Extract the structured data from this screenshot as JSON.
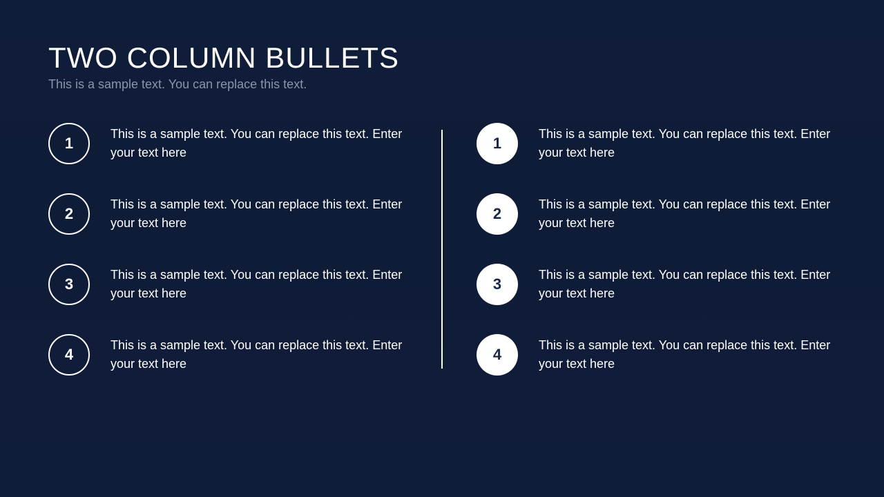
{
  "title": "TWO COLUMN BULLETS",
  "subtitle": "This is a sample text. You can replace this text.",
  "leftColumn": {
    "items": [
      {
        "num": "1",
        "text": "This is a sample text. You can replace this text. Enter your text here"
      },
      {
        "num": "2",
        "text": "This is a sample text. You can replace this text. Enter your text here"
      },
      {
        "num": "3",
        "text": "This is a sample text. You can replace this text. Enter your text here"
      },
      {
        "num": "4",
        "text": "This is a sample text. You can replace this text. Enter your text here"
      }
    ]
  },
  "rightColumn": {
    "items": [
      {
        "num": "1",
        "text": "This is a sample text. You can replace this text. Enter your text here"
      },
      {
        "num": "2",
        "text": "This is a sample text. You can replace this text. Enter your text here"
      },
      {
        "num": "3",
        "text": "This is a sample text. You can replace this text. Enter your text here"
      },
      {
        "num": "4",
        "text": "This is a sample text. You can replace this text. Enter your text here"
      }
    ]
  }
}
